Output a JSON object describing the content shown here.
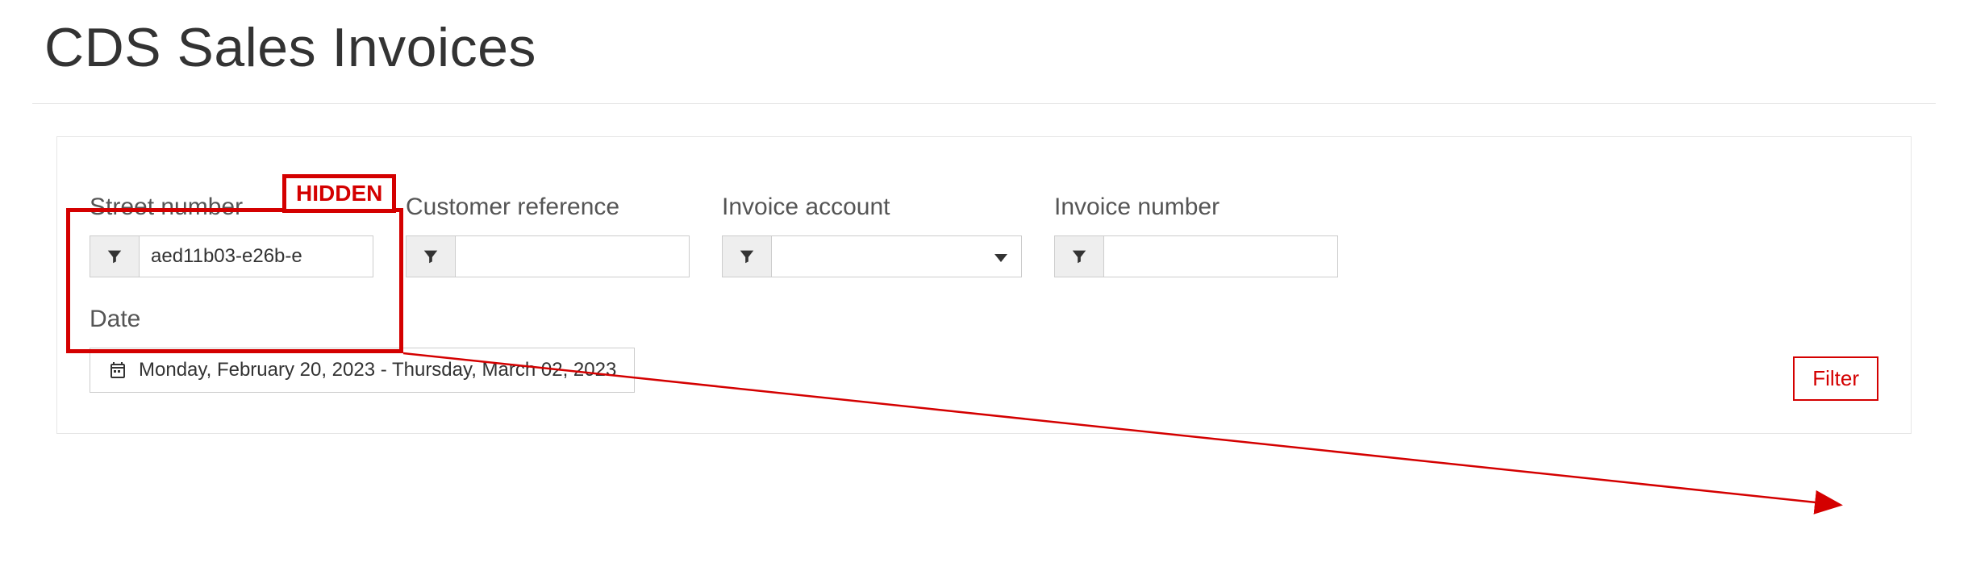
{
  "title": "CDS Sales Invoices",
  "filters": {
    "street_number": {
      "label": "Street number",
      "value": "aed11b03-e26b-e"
    },
    "customer_reference": {
      "label": "Customer reference",
      "value": ""
    },
    "invoice_account": {
      "label": "Invoice account",
      "value": ""
    },
    "invoice_number": {
      "label": "Invoice number",
      "value": ""
    }
  },
  "date": {
    "label": "Date",
    "range_text": "Monday, February 20, 2023 - Thursday, March 02, 2023"
  },
  "actions": {
    "filter_button": "Filter"
  },
  "annotations": {
    "hidden_tag": "HIDDEN"
  },
  "icons": {
    "funnel": "filter-icon",
    "calendar": "calendar-icon"
  },
  "colors": {
    "annotation_red": "#d40000"
  }
}
